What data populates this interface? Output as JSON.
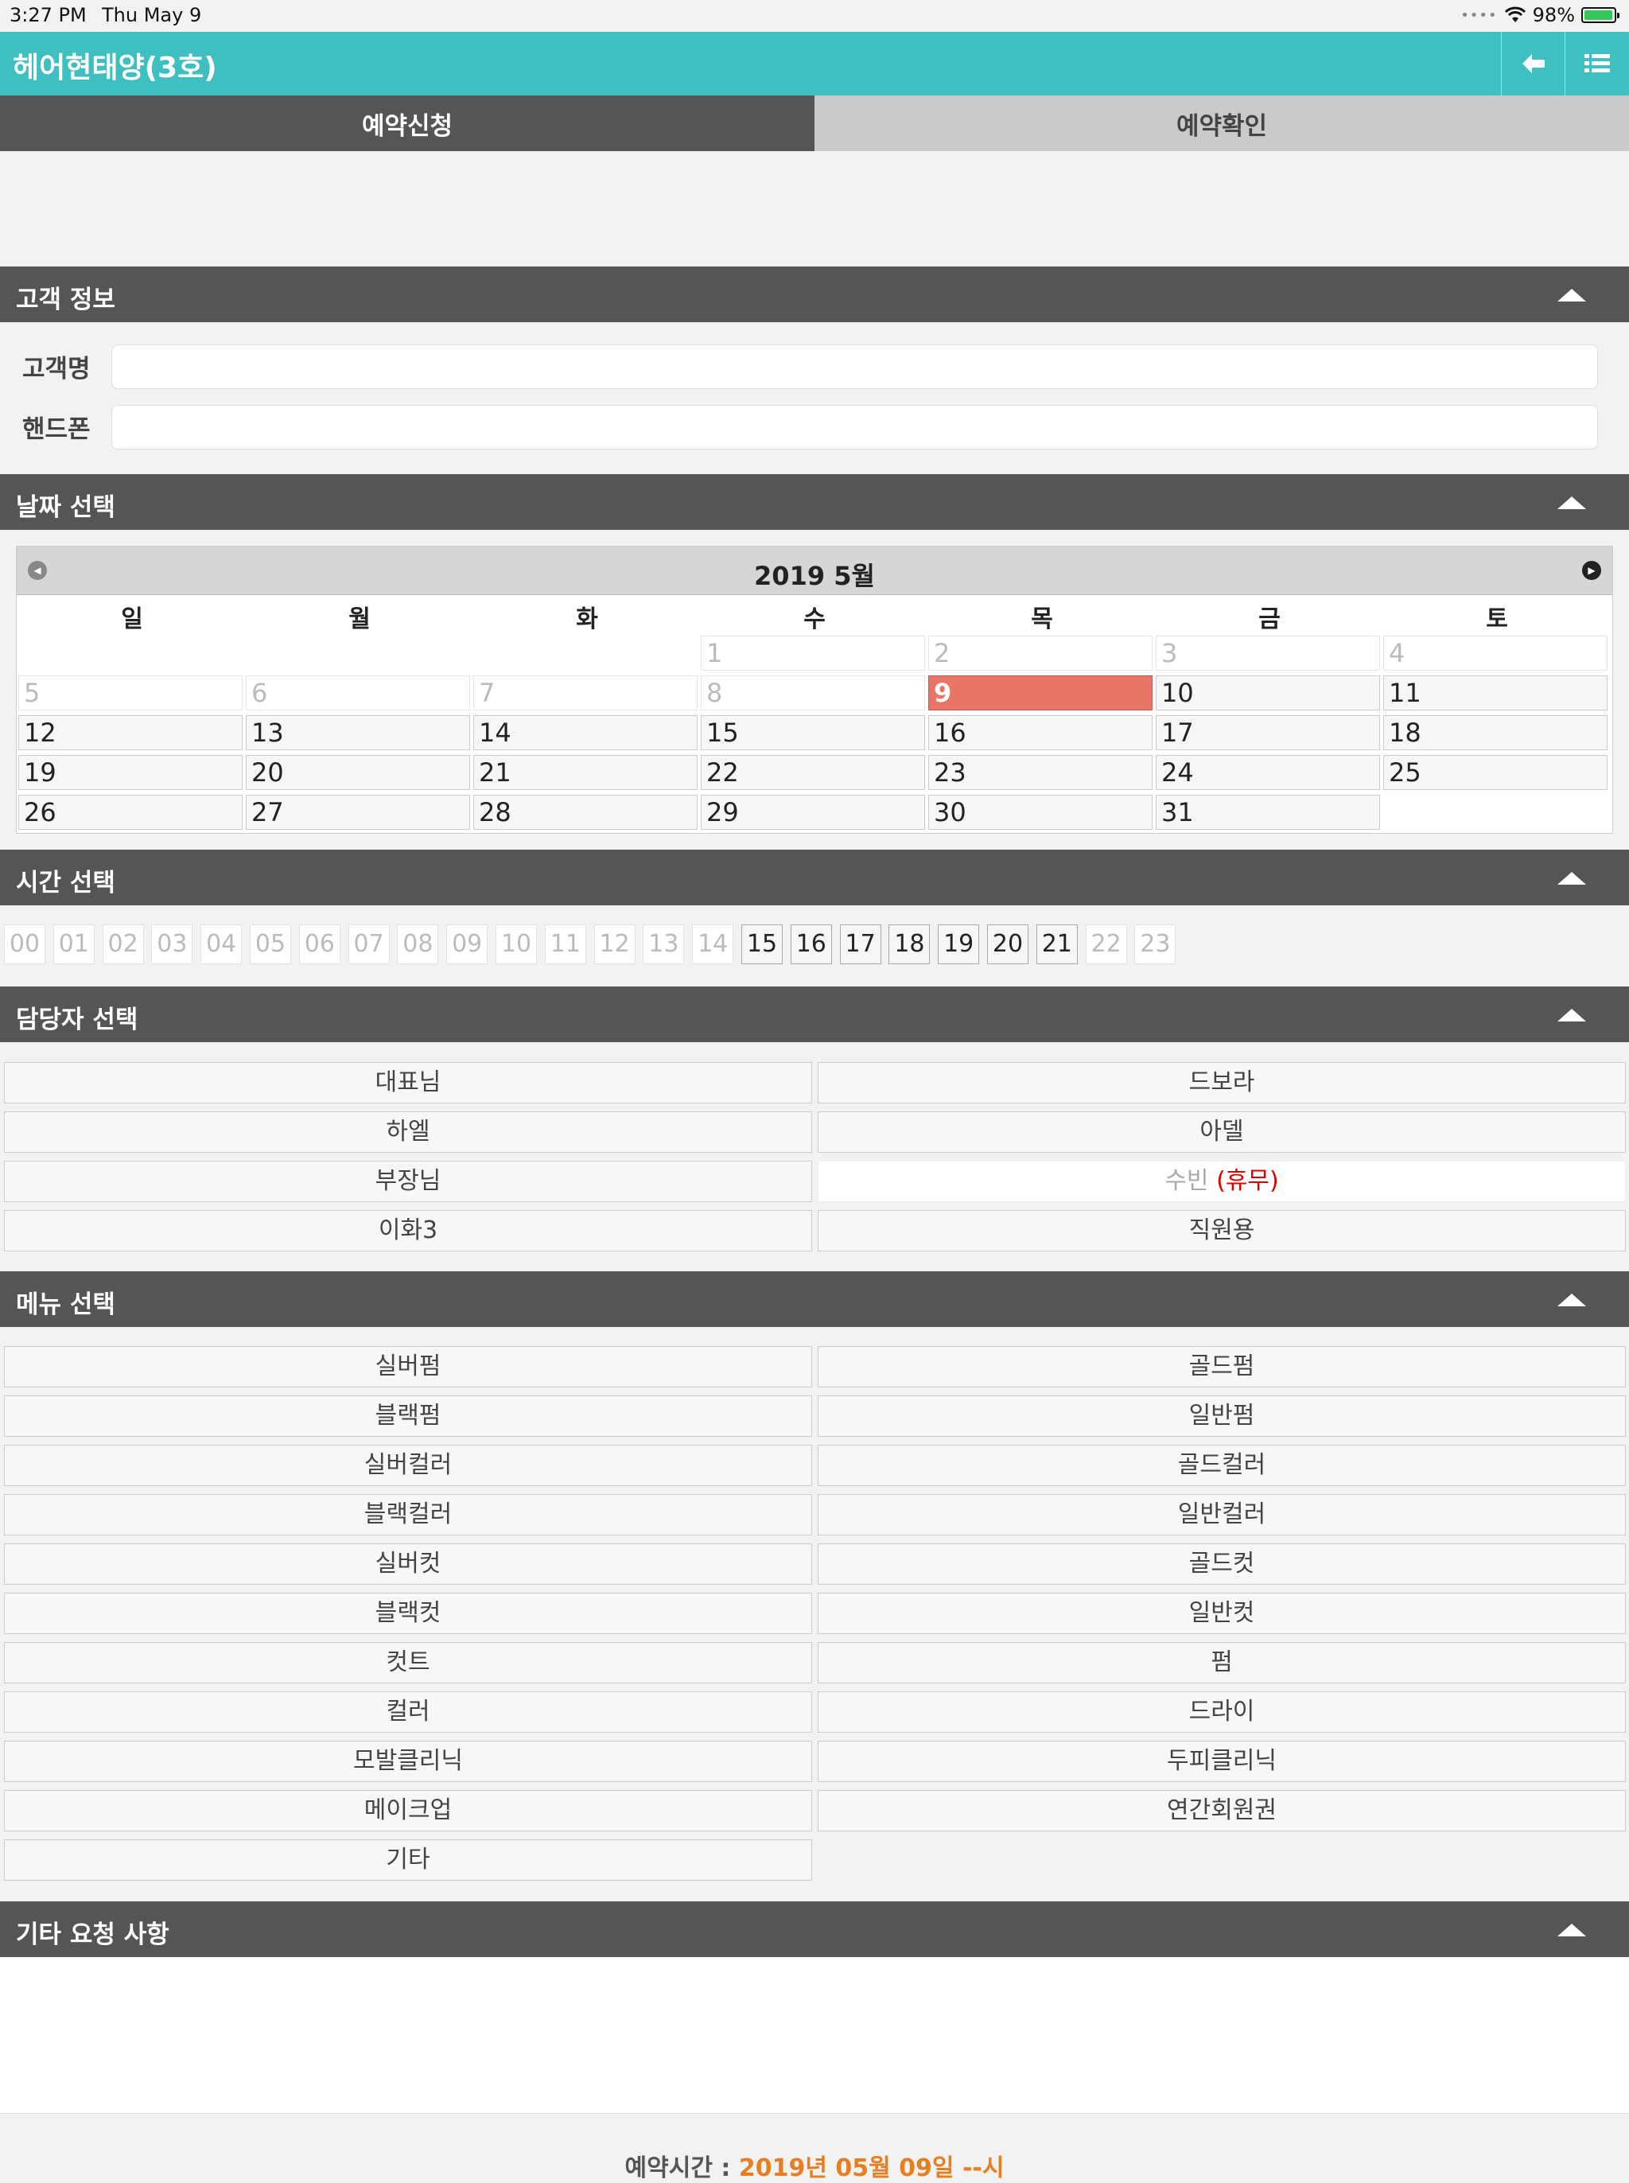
{
  "status": {
    "time": "3:27 PM",
    "date": "Thu May 9",
    "battery": "98%",
    "battery_level": 0.98
  },
  "header": {
    "title": "헤어현태양(3호)",
    "back_icon": "back-arrow-icon",
    "menu_icon": "list-icon"
  },
  "tabs": [
    {
      "label": "예약신청",
      "active": true
    },
    {
      "label": "예약확인",
      "active": false
    }
  ],
  "customer": {
    "section_title": "고객 정보",
    "name_label": "고객명",
    "name_value": "",
    "phone_label": "핸드폰",
    "phone_value": ""
  },
  "date": {
    "section_title": "날짜 선택",
    "month_title": "2019 5월",
    "weekdays": [
      "일",
      "월",
      "화",
      "수",
      "목",
      "금",
      "토"
    ],
    "days": [
      "1",
      "2",
      "3",
      "4",
      "5",
      "6",
      "7",
      "8",
      "9",
      "10",
      "11",
      "12",
      "13",
      "14",
      "15",
      "16",
      "17",
      "18",
      "19",
      "20",
      "21",
      "22",
      "23",
      "24",
      "25",
      "26",
      "27",
      "28",
      "29",
      "30",
      "31"
    ],
    "selected": "9"
  },
  "time": {
    "section_title": "시간 선택",
    "hours": [
      "00",
      "01",
      "02",
      "03",
      "04",
      "05",
      "06",
      "07",
      "08",
      "09",
      "10",
      "11",
      "12",
      "13",
      "14",
      "15",
      "16",
      "17",
      "18",
      "19",
      "20",
      "21",
      "22",
      "23"
    ]
  },
  "staff": {
    "section_title": "담당자 선택",
    "items": [
      {
        "label": "대표님"
      },
      {
        "label": "드보라"
      },
      {
        "label": "하엘"
      },
      {
        "label": "아델"
      },
      {
        "label": "부장님"
      },
      {
        "label": "수빈",
        "off": "(휴무)"
      },
      {
        "label": "이화3"
      },
      {
        "label": "직원용"
      }
    ]
  },
  "menu": {
    "section_title": "메뉴 선택",
    "items": [
      "실버펌",
      "골드펌",
      "블랙펌",
      "일반펌",
      "실버컬러",
      "골드컬러",
      "블랙컬러",
      "일반컬러",
      "실버컷",
      "골드컷",
      "블랙컷",
      "일반컷",
      "컷트",
      "펌",
      "컬러",
      "드라이",
      "모발클리닉",
      "두피클리닉",
      "메이크업",
      "연간회원권",
      "기타"
    ]
  },
  "request": {
    "section_title": "기타 요청 사항",
    "value": ""
  },
  "footer": {
    "label": "예약시간 : ",
    "value": "2019년 05월 09일 --시"
  }
}
